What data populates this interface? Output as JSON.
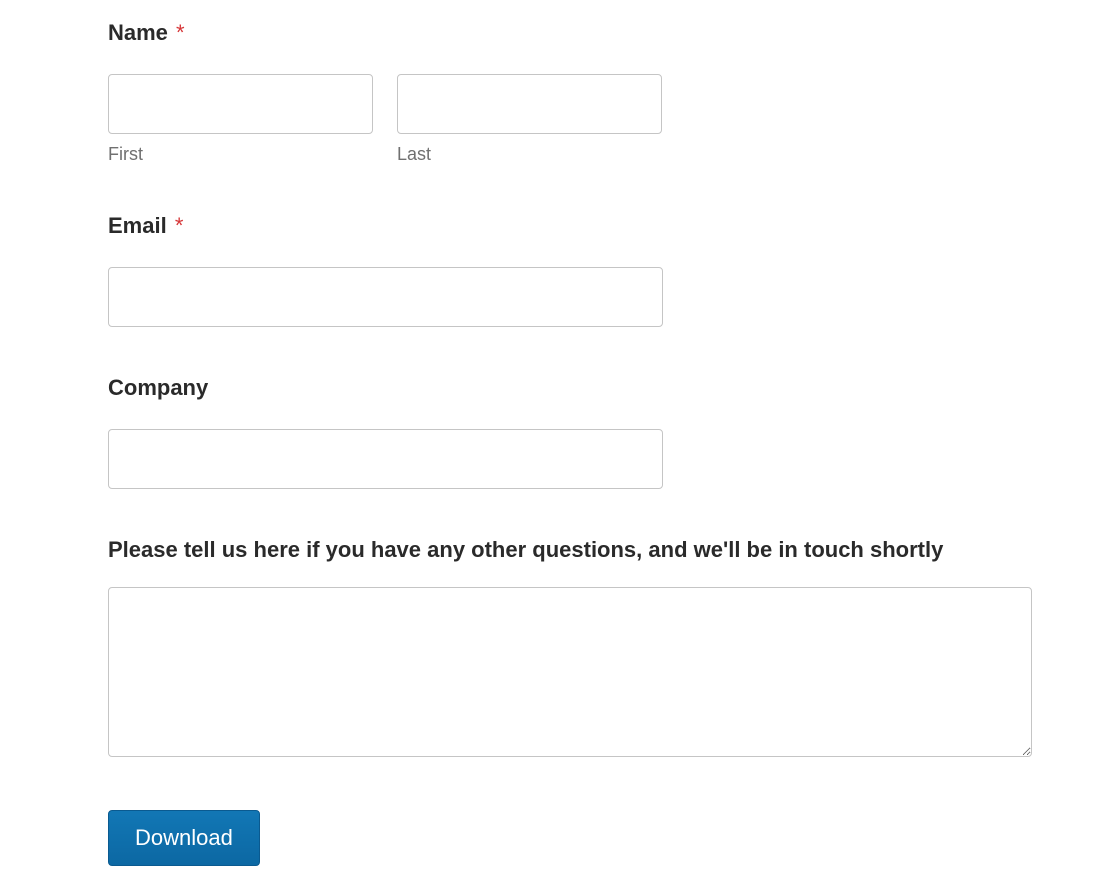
{
  "form": {
    "name": {
      "label": "Name",
      "required_mark": "*",
      "first_sublabel": "First",
      "last_sublabel": "Last",
      "first_value": "",
      "last_value": ""
    },
    "email": {
      "label": "Email",
      "required_mark": "*",
      "value": ""
    },
    "company": {
      "label": "Company",
      "value": ""
    },
    "questions": {
      "label": "Please tell us here if you have any other questions, and we'll be in touch shortly",
      "value": ""
    },
    "submit": {
      "label": "Download"
    }
  }
}
